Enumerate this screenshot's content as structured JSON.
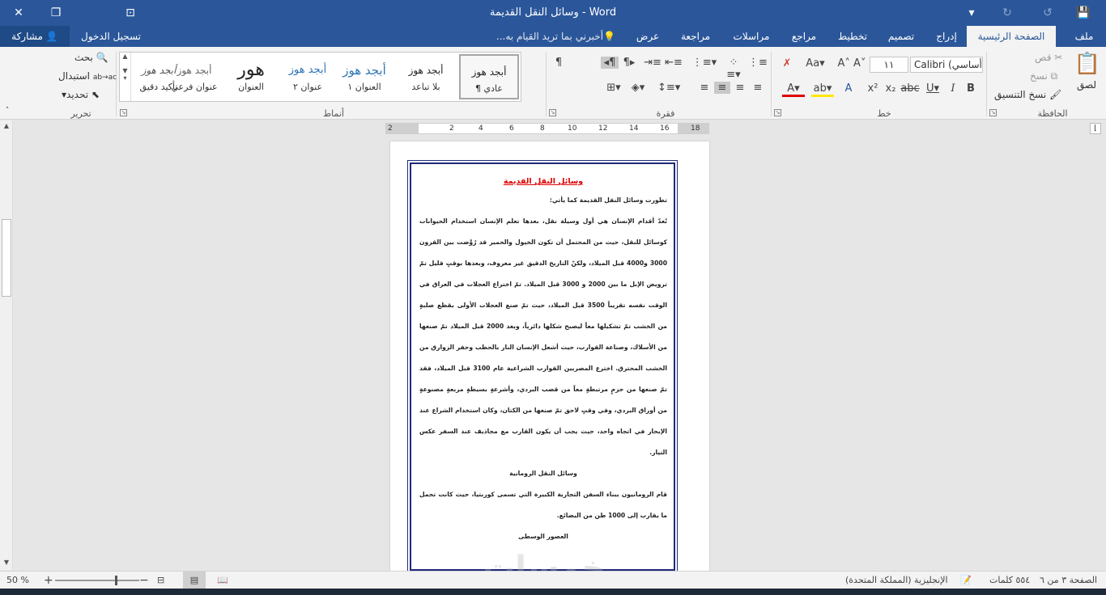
{
  "window": {
    "title": "وسائل النقل القديمة - Word",
    "close_icon": "close-icon",
    "restore_icon": "restore-icon",
    "ribbon_display_icon": "ribbon-display-icon",
    "save_icon": "save-icon"
  },
  "tabs": [
    {
      "label": "ملف",
      "active": false
    },
    {
      "label": "الصفحة الرئيسية",
      "active": true
    },
    {
      "label": "إدراج",
      "active": false
    },
    {
      "label": "تصميم",
      "active": false
    },
    {
      "label": "تخطيط",
      "active": false
    },
    {
      "label": "مراجع",
      "active": false
    },
    {
      "label": "مراسلات",
      "active": false
    },
    {
      "label": "مراجعة",
      "active": false
    },
    {
      "label": "عرض",
      "active": false
    }
  ],
  "tell_me": "أخبرني بما تريد القيام به...",
  "sign_in": "تسجيل الدخول",
  "share": "مشاركة",
  "clipboard": {
    "label": "الحافظة",
    "paste": "لصق",
    "cut": "قص",
    "copy": "نسخ",
    "format_painter": "نسخ التنسيق"
  },
  "font": {
    "label": "خط",
    "name": "Calibri (أساسي)",
    "size": "١١"
  },
  "paragraph": {
    "label": "فقرة"
  },
  "styles": {
    "label": "أنماط",
    "items": [
      {
        "sample": "أبجد هوز",
        "name": "¶ عادي"
      },
      {
        "sample": "أبجد هوز",
        "name": "بلا تباعد"
      },
      {
        "sample": "أبجد هوز",
        "name": "العنوان ١"
      },
      {
        "sample": "أبجد هوز",
        "name": "عنوان ٢"
      },
      {
        "sample": "هور",
        "name": "العنوان"
      },
      {
        "sample": "أبجد هوز",
        "name": "عنوان فرعي"
      },
      {
        "sample": "أبجد هوز",
        "name": "تأكيد دقيق"
      }
    ]
  },
  "editing": {
    "label": "تحرير",
    "find": "بحث",
    "replace": "استبدال",
    "select": "تحديد"
  },
  "ruler": {
    "numbers": [
      "2",
      "2",
      "4",
      "6",
      "8",
      "10",
      "12",
      "14",
      "16",
      "18"
    ]
  },
  "document": {
    "title": "وسائل النقل القديمة",
    "intro": "تطورت وسائل النقل القديمة كما يأتي:",
    "paragraph1": "تُعدّ أقدام الإنسان هي أول وسيلة نقل، بعدها تعلم الإنسان استخدام الحيوانات كوسائل للنقل، حيث من المحتمل أن تكون الخيول والحمير قد رُوِّضت بين القرون 3000 و4000 قبل الميلاد، ولكنّ التاريخ الدقيق غير معروف، وبعدها بوقتٍ قليل تمّ ترويض الإبل ما بين 2000 و 3000 قبل الميلاد. تمّ اختراع العجلات في العراق في الوقت نفسه تقريباً 3500 قبل الميلاد، حيث تمّ صنع العجلات الأولى بقطع صلبةٍ من الخشب تمّ تشكيلها معاً ليصبح شكلها دائرياً، وبعد 2000 قبل الميلاد تمّ صنعها من الأسلاك، وصناعة القوارب، حيث أشعل الإنسان النار بالحطب وحفر الزوارق من الخشب المحترق. اخترع المصريين القوارب الشراعية عام 3100 قبل الميلاد، فقد تمّ صنعها من حزمٍ مرتبطةٍ معاً من قصب البردي، وأشرعةٍ بسيطةٍ مربعةٍ مصنوعةٍ من أوراق البردي، وفي وقتٍ لاحق تمّ صنعها من الكتان، وكان استخدام الشراع عند الإبحار في اتجاه واحد، حيث يجب أن يكون القارب مع مجاذيف عند السفر عكس التيار.",
    "heading2": "وسائل النقل الرومانية",
    "paragraph2": "قام الرومانيون ببناء السفن التجارية الكبيرة التي تسمى كوربتيا، حيث كانت تحمل ما يقارب إلى 1000 طن من البضائع.",
    "heading3": "العصور الوسطى"
  },
  "status": {
    "page": "الصفحة ٣ من ٦",
    "words": "٥٥٤ كلمات",
    "language": "الإنجليزية (المملكة المتحدة)",
    "zoom": "50 %",
    "zoom_level": 0.5
  },
  "watermark": "خمسات"
}
